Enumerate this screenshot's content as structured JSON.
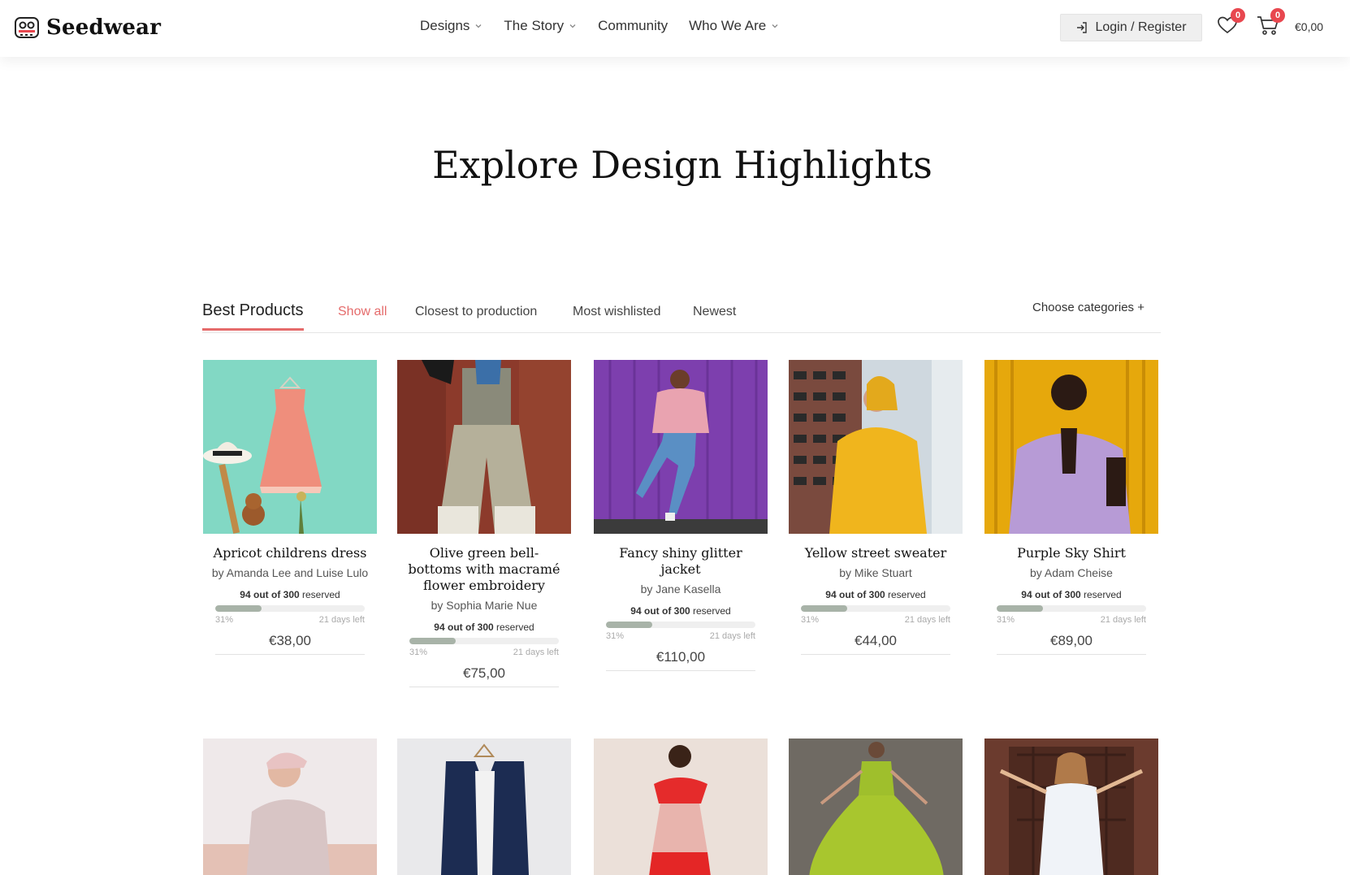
{
  "brand": {
    "name": "Seedwear"
  },
  "nav": {
    "items": [
      {
        "label": "Designs",
        "has_dropdown": true
      },
      {
        "label": "The Story",
        "has_dropdown": true
      },
      {
        "label": "Community",
        "has_dropdown": false
      },
      {
        "label": "Who We Are",
        "has_dropdown": true
      }
    ]
  },
  "header": {
    "login_label": "Login / Register",
    "wishlist_count": "0",
    "cart_count": "0",
    "cart_total": "€0,00"
  },
  "page": {
    "title": "Explore Design Highlights"
  },
  "tabs": {
    "heading": "Best Products",
    "items": [
      {
        "label": "Show all",
        "active": true
      },
      {
        "label": "Closest to production",
        "active": false
      },
      {
        "label": "Most wishlisted",
        "active": false
      },
      {
        "label": "Newest",
        "active": false
      }
    ],
    "choose_categories": "Choose categories +"
  },
  "colors": {
    "accent": "#e56b6b",
    "badge": "#e8474f",
    "progress": "#a8b3a8"
  },
  "products": [
    {
      "title": "Apricot childrens dress",
      "author": "by Amanda Lee and Luise Lulo",
      "reserved_count": "94",
      "reserved_text": "out of 300",
      "reserved_suffix": "reserved",
      "percent_label": "31%",
      "percent": 0.31,
      "days_left": "21 days left",
      "price": "€38,00"
    },
    {
      "title": "Olive green bell-bottoms with macramé flower embroidery",
      "author": "by Sophia Marie Nue",
      "reserved_count": "94",
      "reserved_text": "out of 300",
      "reserved_suffix": "reserved",
      "percent_label": "31%",
      "percent": 0.31,
      "days_left": "21 days left",
      "price": "€75,00"
    },
    {
      "title": "Fancy shiny glitter jacket",
      "author": "by Jane Kasella",
      "reserved_count": "94",
      "reserved_text": "out of 300",
      "reserved_suffix": "reserved",
      "percent_label": "31%",
      "percent": 0.31,
      "days_left": "21 days left",
      "price": "€110,00"
    },
    {
      "title": "Yellow street sweater",
      "author": "by Mike Stuart",
      "reserved_count": "94",
      "reserved_text": "out of 300",
      "reserved_suffix": "reserved",
      "percent_label": "31%",
      "percent": 0.31,
      "days_left": "21 days left",
      "price": "€44,00"
    },
    {
      "title": "Purple Sky Shirt",
      "author": "by Adam Cheise",
      "reserved_count": "94",
      "reserved_text": "out of 300",
      "reserved_suffix": "reserved",
      "percent_label": "31%",
      "percent": 0.31,
      "days_left": "21 days left",
      "price": "€89,00"
    }
  ]
}
